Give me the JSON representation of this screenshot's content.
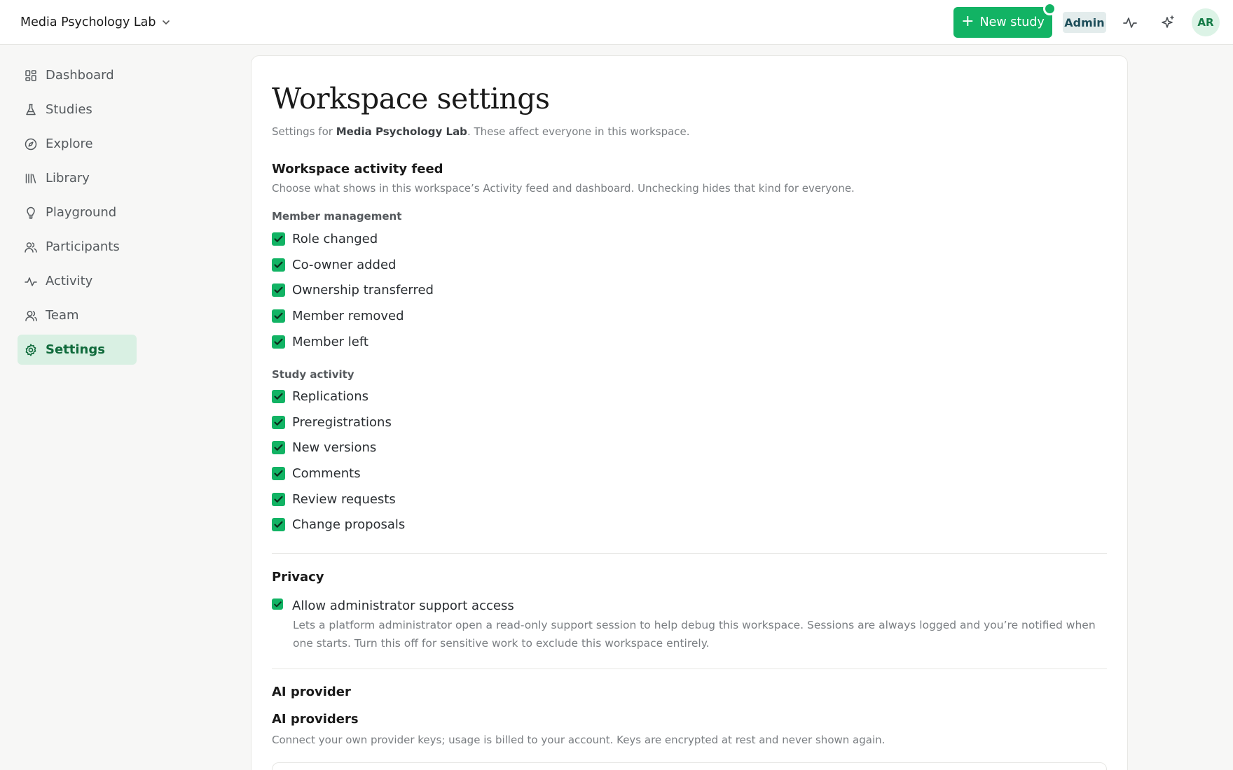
{
  "header": {
    "workspace_name": "Media Psychology Lab",
    "new_study_label": "New study",
    "role_badge": "Admin",
    "avatar_initials": "AR"
  },
  "sidebar": {
    "items": [
      {
        "label": "Dashboard",
        "icon": "dashboard-icon"
      },
      {
        "label": "Studies",
        "icon": "flask-icon"
      },
      {
        "label": "Explore",
        "icon": "compass-icon"
      },
      {
        "label": "Library",
        "icon": "library-icon"
      },
      {
        "label": "Playground",
        "icon": "lightbulb-icon"
      },
      {
        "label": "Participants",
        "icon": "users-icon"
      },
      {
        "label": "Activity",
        "icon": "activity-icon"
      },
      {
        "label": "Team",
        "icon": "team-icon"
      },
      {
        "label": "Settings",
        "icon": "gear-icon",
        "active": true
      }
    ]
  },
  "page": {
    "title": "Workspace settings",
    "subtitle_prefix": "Settings for ",
    "subtitle_workspace": "Media Psychology Lab",
    "subtitle_suffix": ". These affect everyone in this workspace."
  },
  "activity_feed": {
    "title": "Workspace activity feed",
    "description": "Choose what shows in this workspace’s Activity feed and dashboard. Unchecking hides that kind for everyone.",
    "member_group_label": "Member management",
    "member_items": [
      {
        "label": "Role changed",
        "checked": true
      },
      {
        "label": "Co-owner added",
        "checked": true
      },
      {
        "label": "Ownership transferred",
        "checked": true
      },
      {
        "label": "Member removed",
        "checked": true
      },
      {
        "label": "Member left",
        "checked": true
      }
    ],
    "study_group_label": "Study activity",
    "study_items": [
      {
        "label": "Replications",
        "checked": true
      },
      {
        "label": "Preregistrations",
        "checked": true
      },
      {
        "label": "New versions",
        "checked": true
      },
      {
        "label": "Comments",
        "checked": true
      },
      {
        "label": "Review requests",
        "checked": true
      },
      {
        "label": "Change proposals",
        "checked": true
      }
    ]
  },
  "privacy": {
    "title": "Privacy",
    "support_access_label": "Allow administrator support access",
    "support_access_checked": true,
    "support_access_description": "Lets a platform administrator open a read-only support session to help debug this workspace. Sessions are always logged and you’re notified when one starts. Turn this off for sensitive work to exclude this workspace entirely."
  },
  "ai": {
    "section_title": "AI provider",
    "providers_title": "AI providers",
    "providers_description": "Connect your own provider keys; usage is billed to your account. Keys are encrypted at rest and never shown again."
  },
  "colors": {
    "accent": "#12b364",
    "sidebar_active_bg": "#d9f0e3",
    "sidebar_active_text": "#0f6a3b"
  }
}
